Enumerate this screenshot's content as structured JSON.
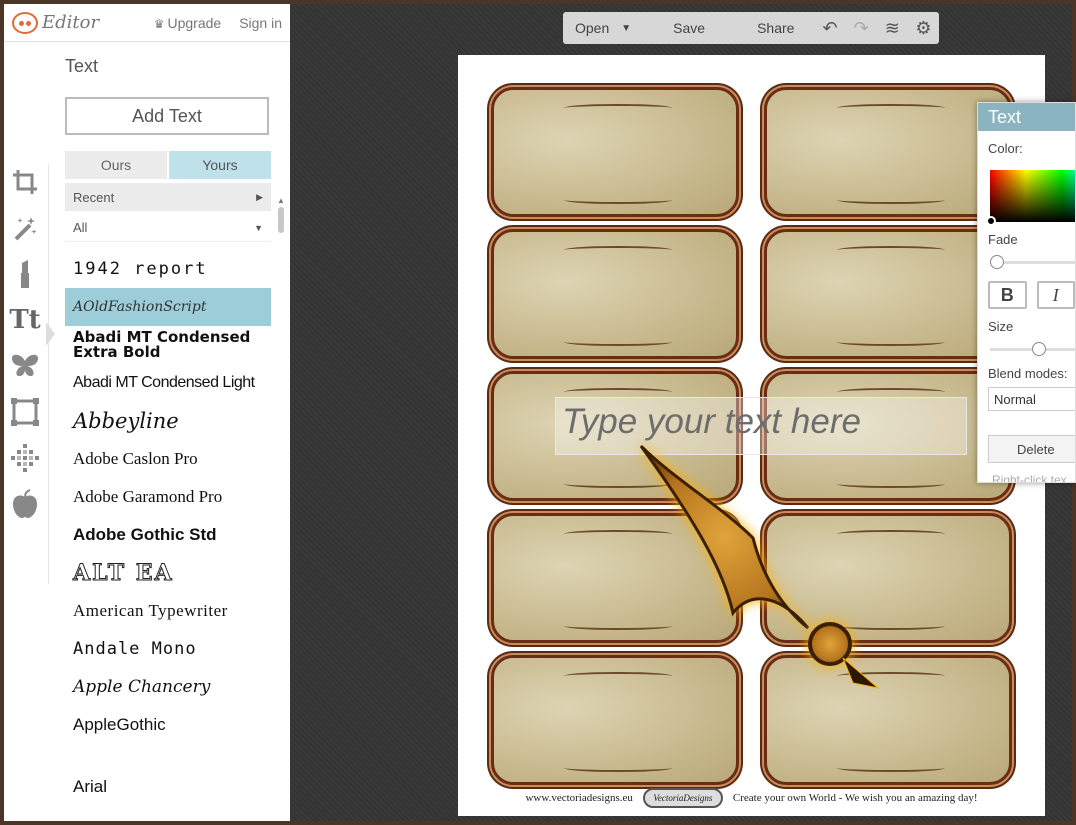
{
  "app": {
    "logo_text": "Editor",
    "upgrade": "Upgrade",
    "signin": "Sign in"
  },
  "toolbar": {
    "open": "Open",
    "save": "Save",
    "share": "Share"
  },
  "panel": {
    "title": "Text",
    "add_text": "Add Text",
    "tabs": [
      "Ours",
      "Yours"
    ],
    "active_tab": "Yours",
    "filter_recent": "Recent",
    "filter_all": "All",
    "fonts": [
      "1942 report",
      "AOldFashionScript",
      "Abadi MT Condensed Extra Bold",
      "Abadi MT Condensed Light",
      "Abbeyline",
      "Adobe Caslon Pro",
      "Adobe Garamond Pro",
      "Adobe Gothic Std",
      "ALT EA",
      "American Typewriter",
      "Andale Mono",
      "Apple Chancery",
      "AppleGothic",
      "Arial"
    ],
    "selected_font": "AOldFashionScript"
  },
  "canvas": {
    "placeholder_text": "Type your text here",
    "footer_left": "www.vectoriadesigns.eu",
    "footer_badge": "VectoriaDesigns",
    "footer_right": "Create your own World - We wish you an amazing day!"
  },
  "text_settings": {
    "title": "Text",
    "color_label": "Color:",
    "fade_label": "Fade",
    "bold": "B",
    "italic": "I",
    "size_label": "Size",
    "blend_label": "Blend modes:",
    "blend_value": "Normal",
    "delete": "Delete",
    "hint": "Right-click tex",
    "fade": 0.0,
    "size": 0.55
  }
}
